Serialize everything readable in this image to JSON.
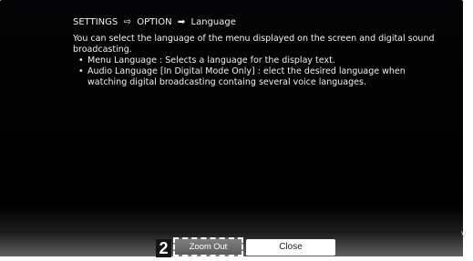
{
  "settings_help": {
    "breadcrumb": {
      "settings": "SETTINGS",
      "separator_1_icon": "open-right-arrow-icon",
      "separator_1": "⇨",
      "option": "OPTION",
      "separator_2_icon": "solid-right-arrow-icon",
      "separator_2": "➡",
      "language": "Language"
    },
    "description": "You can select the language of the menu displayed on the screen and digital sound broadcasting.",
    "bullets": [
      "Menu Language : Selects a language for the display text.",
      "Audio Language [In Digital Mode Only] : elect the desired language when watching digital broadcasting containg several voice languages."
    ]
  },
  "footer": {
    "step_number": "2",
    "zoom_out_label": "Zoom Out",
    "close_label": "Close",
    "right_edge_glyph": "V"
  },
  "colors": {
    "panel_background": "#000000",
    "body_text": "#f1f1f1",
    "footer_bar": "#626262",
    "focus_border": "#ffffff",
    "close_button": "#ffffff"
  }
}
